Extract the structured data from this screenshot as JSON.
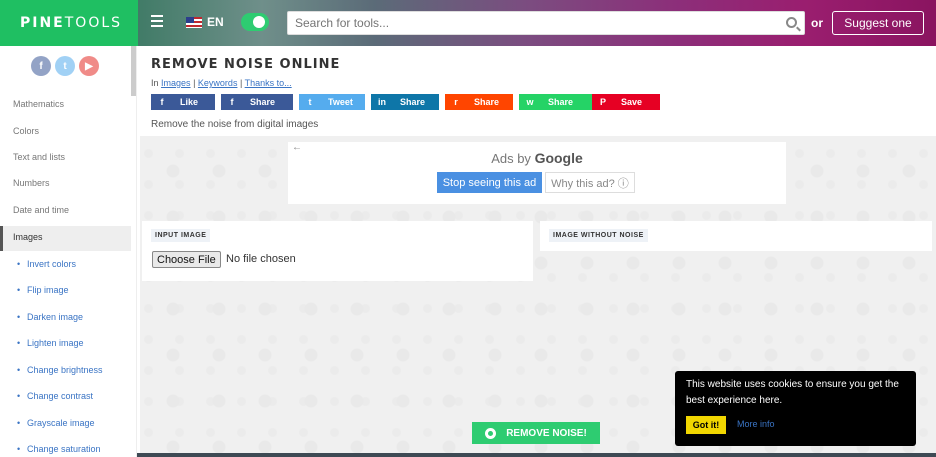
{
  "topbar": {
    "logo_bold": "PINE",
    "logo_rest": "TOOLS",
    "language": "EN",
    "search_placeholder": "Search for tools...",
    "or_text": "or",
    "suggest_label": "Suggest one",
    "colors": {
      "logo_bg": "#1fbf62",
      "toggle": "#2ecc71"
    }
  },
  "sidebar": {
    "social": [
      "f",
      "t",
      "▶"
    ],
    "categories": [
      "Mathematics",
      "Colors",
      "Text and lists",
      "Numbers",
      "Date and time",
      "Images"
    ],
    "active_category": "Images",
    "sub_items": [
      "Invert colors",
      "Flip image",
      "Darken image",
      "Lighten image",
      "Change brightness",
      "Change contrast",
      "Grayscale image",
      "Change saturation"
    ]
  },
  "page": {
    "title": "REMOVE NOISE ONLINE",
    "in_text": "In",
    "crumb_images": "Images",
    "crumb_keywords": "Keywords",
    "crumb_thanks": "Thanks to...",
    "sep": "|",
    "description": "Remove the noise from digital images"
  },
  "share": [
    {
      "icon": "f",
      "label": "Like",
      "color": "#3b5998"
    },
    {
      "icon": "f",
      "label": "Share",
      "color": "#3b5998"
    },
    {
      "icon": "t",
      "label": "Tweet",
      "color": "#55acee"
    },
    {
      "icon": "in",
      "label": "Share",
      "color": "#0e76a8"
    },
    {
      "icon": "r",
      "label": "Share",
      "color": "#ff4500"
    },
    {
      "icon": "w",
      "label": "Share",
      "color": "#25d366"
    },
    {
      "icon": "P",
      "label": "Save",
      "color": "#e60023"
    }
  ],
  "ad": {
    "ads_by": "Ads by",
    "google": "Google",
    "stop": "Stop seeing this ad",
    "why": "Why this ad? ⓘ"
  },
  "panels": {
    "input_label": "INPUT IMAGE",
    "output_label": "IMAGE WITHOUT NOISE",
    "choose_file": "Choose File",
    "no_file": "No file chosen"
  },
  "action": {
    "remove_label": "REMOVE NOISE!"
  },
  "cookie": {
    "text": "This website uses cookies to ensure you get the best experience here.",
    "got_it": "Got it!",
    "more_info": "More info"
  }
}
